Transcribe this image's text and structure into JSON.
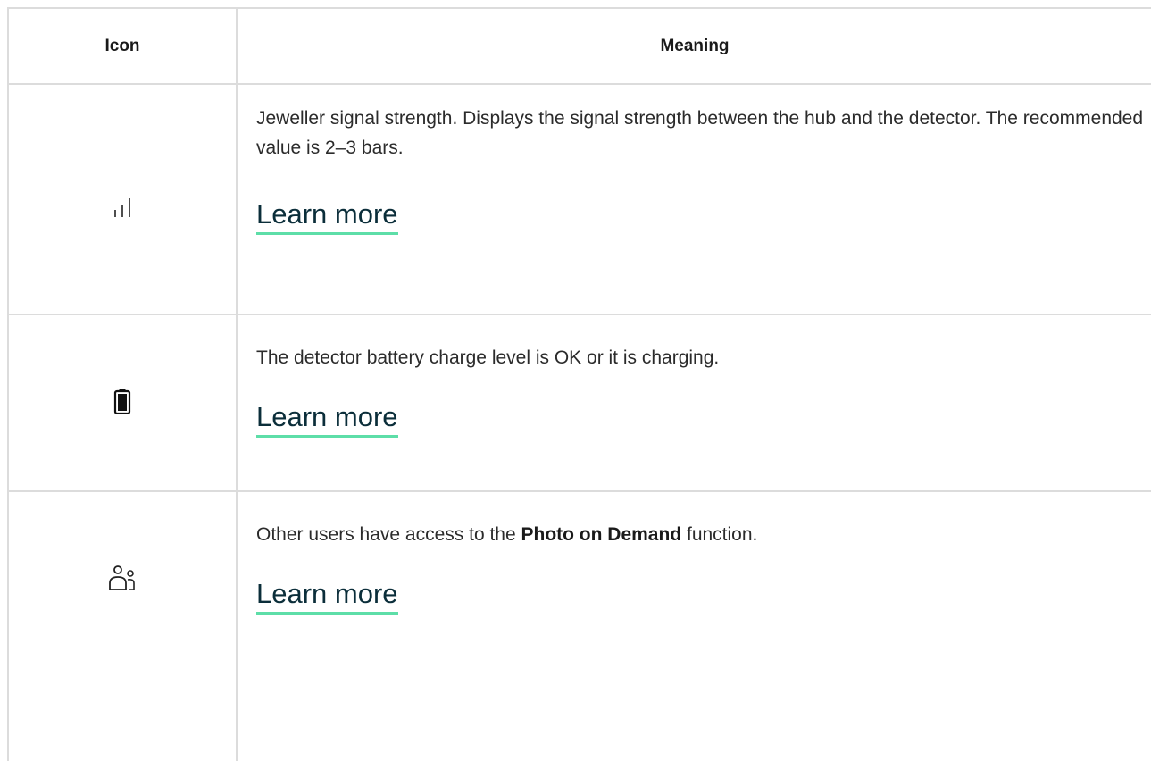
{
  "table": {
    "headers": {
      "icon": "Icon",
      "meaning": "Meaning"
    },
    "rows": [
      {
        "icon": "signal-strength-icon",
        "description": "Jeweller signal strength. Displays the signal strength between the hub and the detector. The recommended value is 2–3 bars.",
        "link": "Learn more"
      },
      {
        "icon": "battery-icon",
        "description": "The detector battery charge level is OK or it is charging.",
        "link": "Learn more"
      },
      {
        "icon": "shared-users-icon",
        "description_before": "Other users have access to the ",
        "description_bold": "Photo on Demand",
        "description_after": " function.",
        "link": "Learn more"
      }
    ]
  },
  "colors": {
    "link_underline": "#5ddea8",
    "link_text": "#0b2e3a",
    "border": "#dcdcdc"
  }
}
